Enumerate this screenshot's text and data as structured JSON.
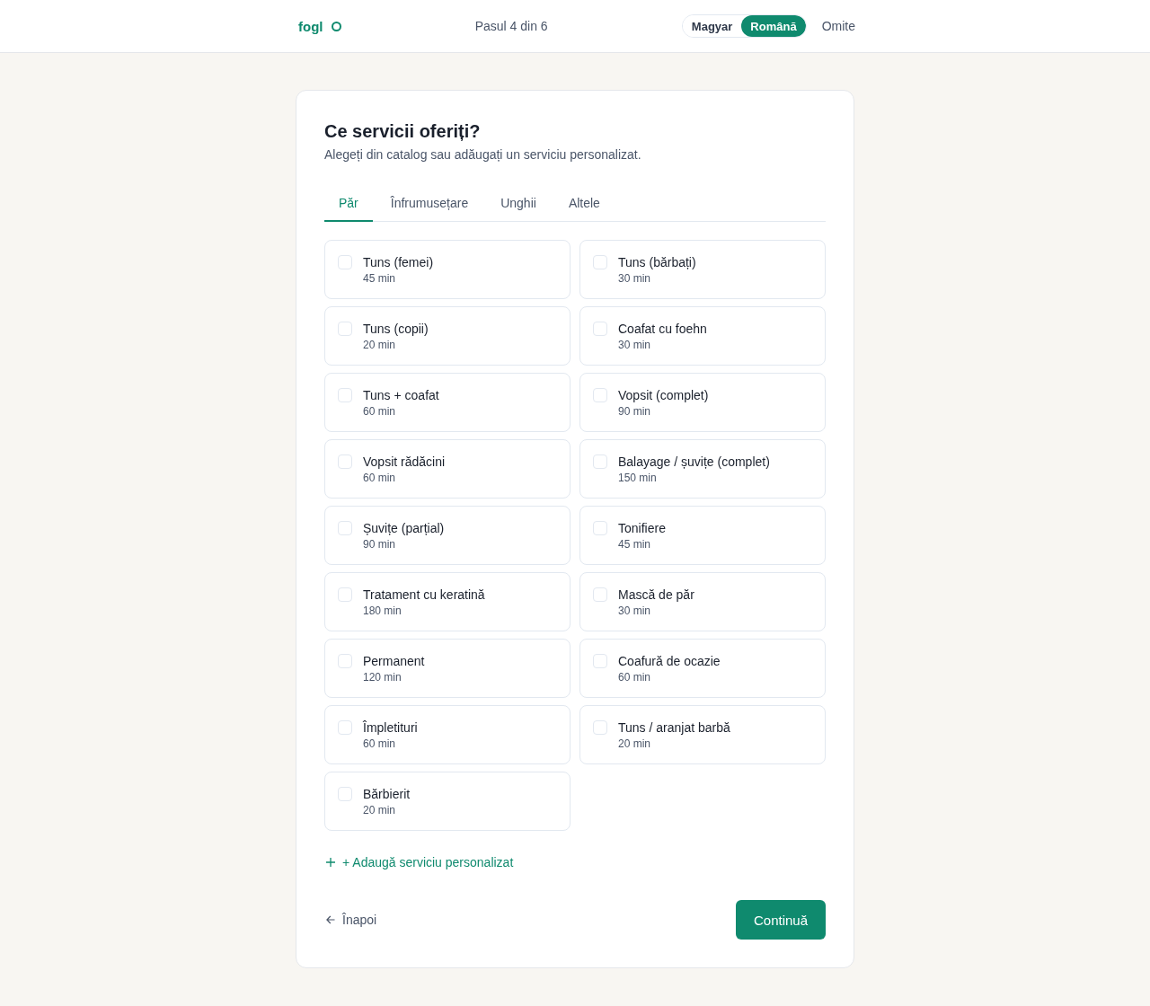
{
  "header": {
    "logo": "fogl",
    "step": "Pasul 4 din 6",
    "languages": [
      {
        "label": "Magyar",
        "selected": false
      },
      {
        "label": "Română",
        "selected": true
      }
    ],
    "skip": "Omite"
  },
  "card": {
    "title": "Ce servicii oferiți?",
    "subtitle": "Alegeți din catalog sau adăugați un serviciu personalizat.",
    "tabs": [
      {
        "label": "Păr",
        "selected": true
      },
      {
        "label": "Înfrumusețare",
        "selected": false
      },
      {
        "label": "Unghii",
        "selected": false
      },
      {
        "label": "Altele",
        "selected": false
      }
    ],
    "services": [
      {
        "name": "Tuns (femei)",
        "duration": "45 min",
        "checked": false
      },
      {
        "name": "Tuns (bărbați)",
        "duration": "30 min",
        "checked": false
      },
      {
        "name": "Tuns (copii)",
        "duration": "20 min",
        "checked": false
      },
      {
        "name": "Coafat cu foehn",
        "duration": "30 min",
        "checked": false
      },
      {
        "name": "Tuns + coafat",
        "duration": "60 min",
        "checked": false
      },
      {
        "name": "Vopsit (complet)",
        "duration": "90 min",
        "checked": false
      },
      {
        "name": "Vopsit rădăcini",
        "duration": "60 min",
        "checked": false
      },
      {
        "name": "Balayage / șuvițe (complet)",
        "duration": "150 min",
        "checked": false
      },
      {
        "name": "Șuvițe (parțial)",
        "duration": "90 min",
        "checked": false
      },
      {
        "name": "Tonifiere",
        "duration": "45 min",
        "checked": false
      },
      {
        "name": "Tratament cu keratină",
        "duration": "180 min",
        "checked": false
      },
      {
        "name": "Mască de păr",
        "duration": "30 min",
        "checked": false
      },
      {
        "name": "Permanent",
        "duration": "120 min",
        "checked": false
      },
      {
        "name": "Coafură de ocazie",
        "duration": "60 min",
        "checked": false
      },
      {
        "name": "Împletituri",
        "duration": "60 min",
        "checked": false
      },
      {
        "name": "Tuns / aranjat barbă",
        "duration": "20 min",
        "checked": false
      },
      {
        "name": "Bărbierit",
        "duration": "20 min",
        "checked": false
      }
    ],
    "add_custom": "+ Adaugă serviciu personalizat",
    "back": "Înapoi",
    "continue": "Continuă"
  }
}
